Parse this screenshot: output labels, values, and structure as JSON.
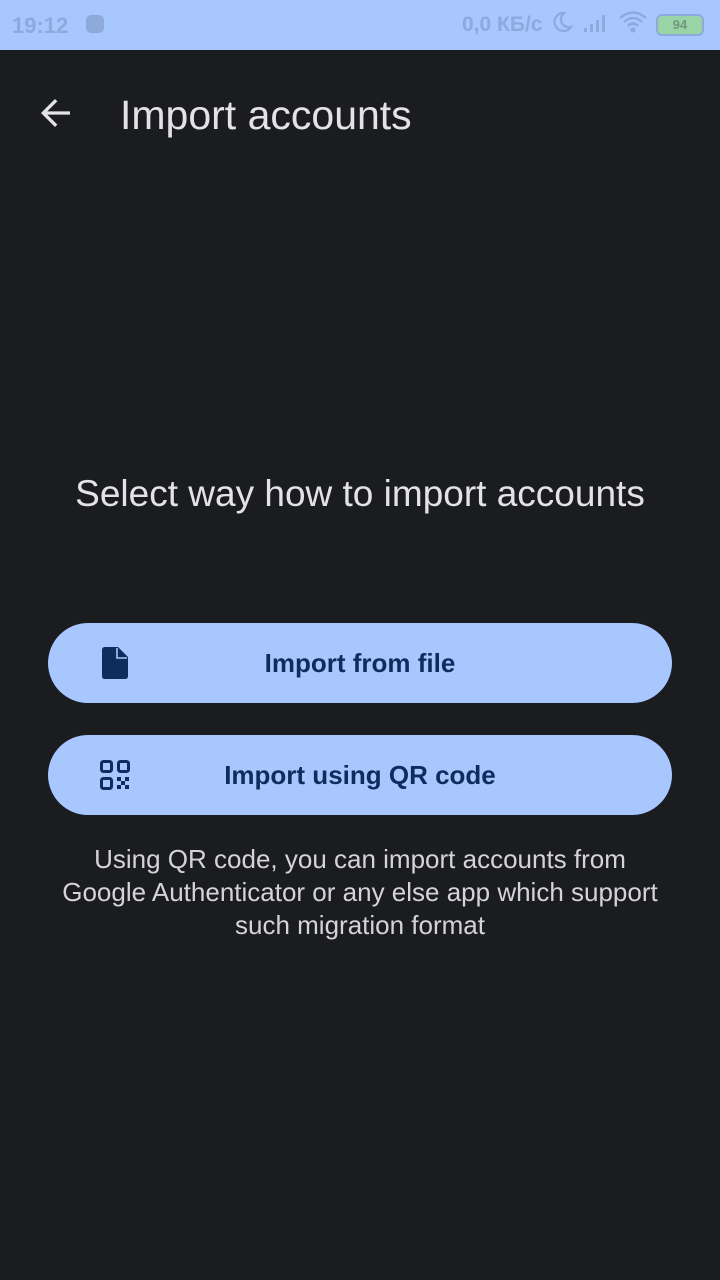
{
  "status_bar": {
    "time": "19:12",
    "network_speed": "0,0 КБ/с",
    "battery_level": "94",
    "icons": [
      "notification-icon",
      "moon-icon",
      "signal-icon",
      "wifi-icon",
      "battery-icon"
    ]
  },
  "app_bar": {
    "title": "Import accounts",
    "back_icon": "arrow-back-icon"
  },
  "main": {
    "headline": "Select way how to import accounts",
    "buttons": [
      {
        "label": "Import from file",
        "icon": "file-icon"
      },
      {
        "label": "Import using QR code",
        "icon": "qr-code-icon"
      }
    ],
    "hint": "Using QR code, you can import accounts from Google Authenticator or any else app which support such migration format"
  },
  "colors": {
    "background": "#1b1c20",
    "accent": "#a9c7ff",
    "button_text": "#0f2d5c",
    "text": "#e3e2e9"
  }
}
